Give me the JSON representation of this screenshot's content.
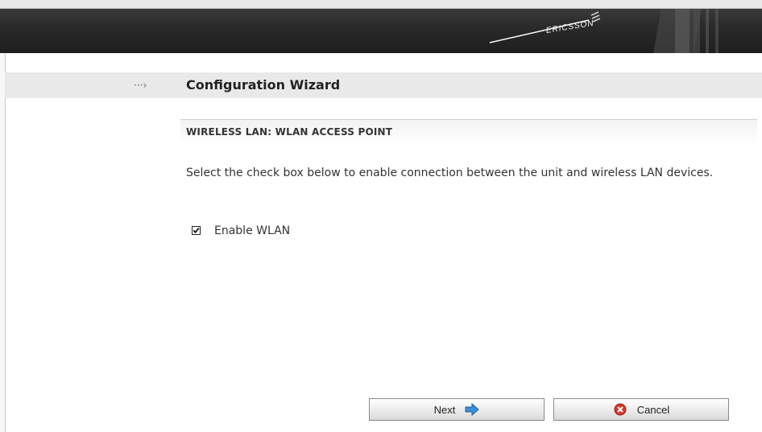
{
  "header": {
    "brand": "ERICSSON"
  },
  "wizard": {
    "arrow": "···›",
    "title": "Configuration Wizard"
  },
  "section": {
    "title": "WIRELESS LAN: WLAN ACCESS POINT",
    "description": "Select the check box below to enable connection between the unit and wireless LAN devices."
  },
  "form": {
    "enable_wlan": {
      "label": "Enable WLAN",
      "checked": true
    }
  },
  "buttons": {
    "next": {
      "label": "Next",
      "icon": "arrow-right-icon"
    },
    "cancel": {
      "label": "Cancel",
      "icon": "cancel-icon"
    }
  },
  "colors": {
    "banner": "#2a2a2a",
    "arrow_icon": "#3a8fd6",
    "cancel_icon": "#d9362b"
  }
}
